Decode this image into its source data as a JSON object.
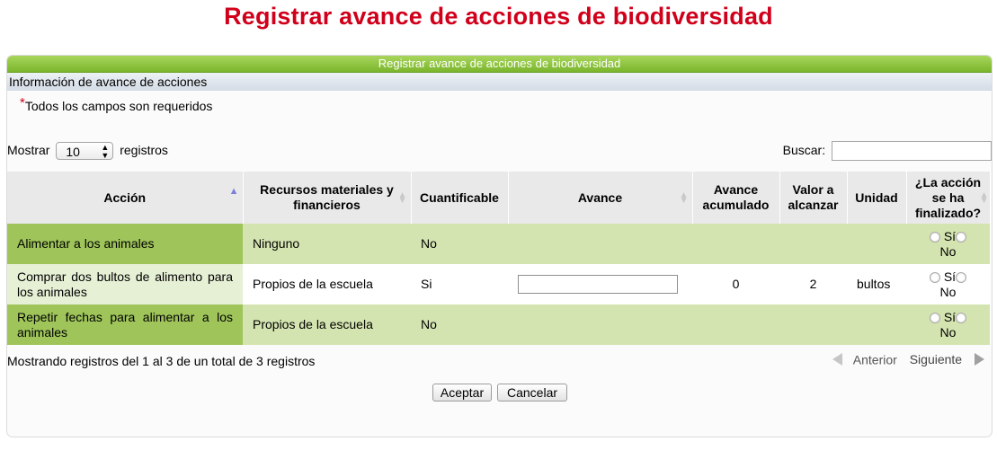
{
  "page": {
    "title": "Registrar avance de acciones de biodiversidad"
  },
  "panel": {
    "header": "Registrar avance de acciones de biodiversidad",
    "section_title": "Información de avance de acciones",
    "required_star": "*",
    "required_note": "Todos los campos son requeridos"
  },
  "table_controls": {
    "show_label": "Mostrar",
    "page_length": "10",
    "records_label": "registros",
    "search_label": "Buscar:",
    "search_value": ""
  },
  "table": {
    "columns": [
      "Acción",
      "Recursos materiales y financieros",
      "Cuantificable",
      "Avance",
      "Avance acumulado",
      "Valor a alcanzar",
      "Unidad",
      "¿La acción se ha finalizado?"
    ],
    "rows": [
      {
        "accion": "Alimentar a los animales",
        "recursos": "Ninguno",
        "cuantificable": "No",
        "avance": "",
        "acumulado": "",
        "valor": "",
        "unidad": "",
        "si": "Sí",
        "no": "No"
      },
      {
        "accion": "Comprar dos bultos de alimento para los animales",
        "recursos": "Propios de la escuela",
        "cuantificable": "Si",
        "avance": "",
        "acumulado": "0",
        "valor": "2",
        "unidad": "bultos",
        "si": "Sí",
        "no": "No"
      },
      {
        "accion": "Repetir fechas para alimentar a los animales",
        "recursos": "Propios de la escuela",
        "cuantificable": "No",
        "avance": "",
        "acumulado": "",
        "valor": "",
        "unidad": "",
        "si": "Sí",
        "no": "No"
      }
    ]
  },
  "footer": {
    "info": "Mostrando registros del 1 al 3 de un total de 3 registros",
    "previous": "Anterior",
    "next": "Siguiente"
  },
  "buttons": {
    "accept": "Aceptar",
    "cancel": "Cancelar"
  },
  "colors": {
    "title_red": "#d0001b",
    "header_green": "#8cc63f",
    "row_first_col": "#9fc55a",
    "row_green": "#d4e4b0"
  },
  "icons": {
    "sort_asc": "sort-ascending-icon",
    "sort": "sort-icon",
    "prev": "triangle-left-icon",
    "next": "triangle-right-icon"
  }
}
